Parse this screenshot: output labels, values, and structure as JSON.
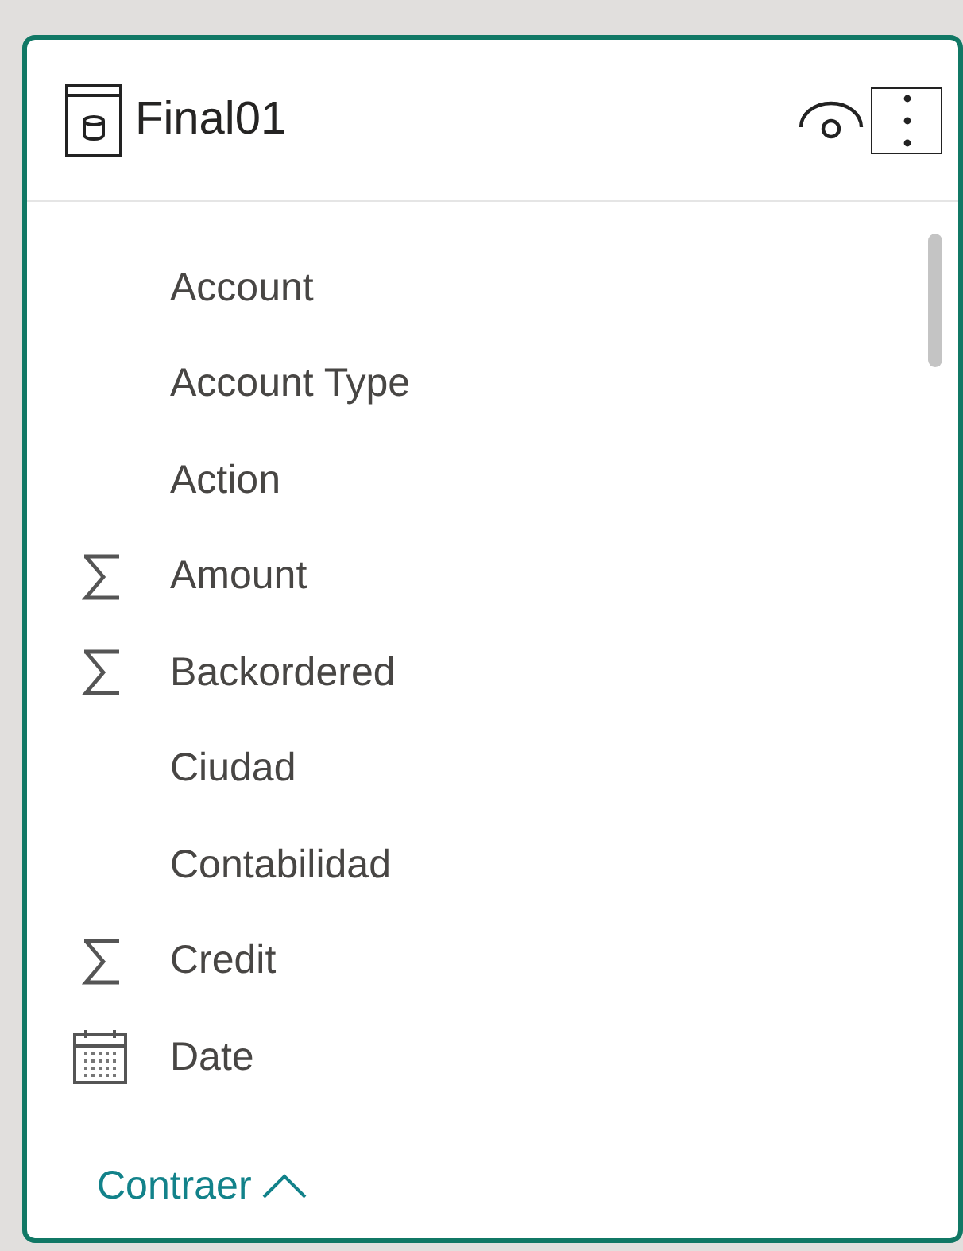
{
  "table": {
    "title": "Final01"
  },
  "fields": [
    {
      "name": "Account",
      "kind": "text"
    },
    {
      "name": "Account Type",
      "kind": "text"
    },
    {
      "name": "Action",
      "kind": "text"
    },
    {
      "name": "Amount",
      "kind": "sum"
    },
    {
      "name": "Backordered",
      "kind": "sum"
    },
    {
      "name": "Ciudad",
      "kind": "text"
    },
    {
      "name": "Contabilidad",
      "kind": "text"
    },
    {
      "name": "Credit",
      "kind": "sum"
    },
    {
      "name": "Date",
      "kind": "date"
    }
  ],
  "collapse_link": {
    "label": "Contraer"
  }
}
